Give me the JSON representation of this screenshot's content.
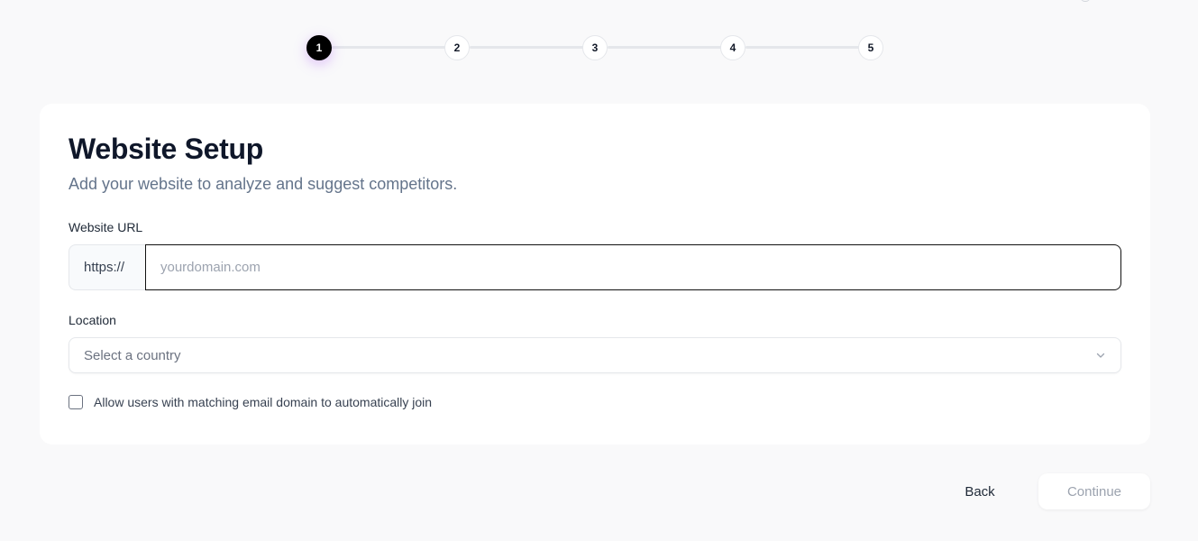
{
  "stepper": {
    "steps": [
      {
        "label": "1",
        "active": true
      },
      {
        "label": "2",
        "active": false
      },
      {
        "label": "3",
        "active": false
      },
      {
        "label": "4",
        "active": false
      },
      {
        "label": "5",
        "active": false
      }
    ],
    "current_step": 1
  },
  "card": {
    "title": "Website Setup",
    "subtitle": "Add your website to analyze and suggest competitors.",
    "url_label": "Website URL",
    "url_prefix": "https://",
    "url_value": "",
    "url_placeholder": "yourdomain.com",
    "location_label": "Location",
    "location_placeholder": "Select a country",
    "checkbox_label": "Allow users with matching email domain to automatically join",
    "checkbox_checked": false
  },
  "footer": {
    "back_label": "Back",
    "continue_label": "Continue"
  },
  "colors": {
    "background": "#f9f9fa",
    "active_step": "#000000",
    "active_glow": "#a855f7",
    "disabled_text": "#9ca3af"
  }
}
